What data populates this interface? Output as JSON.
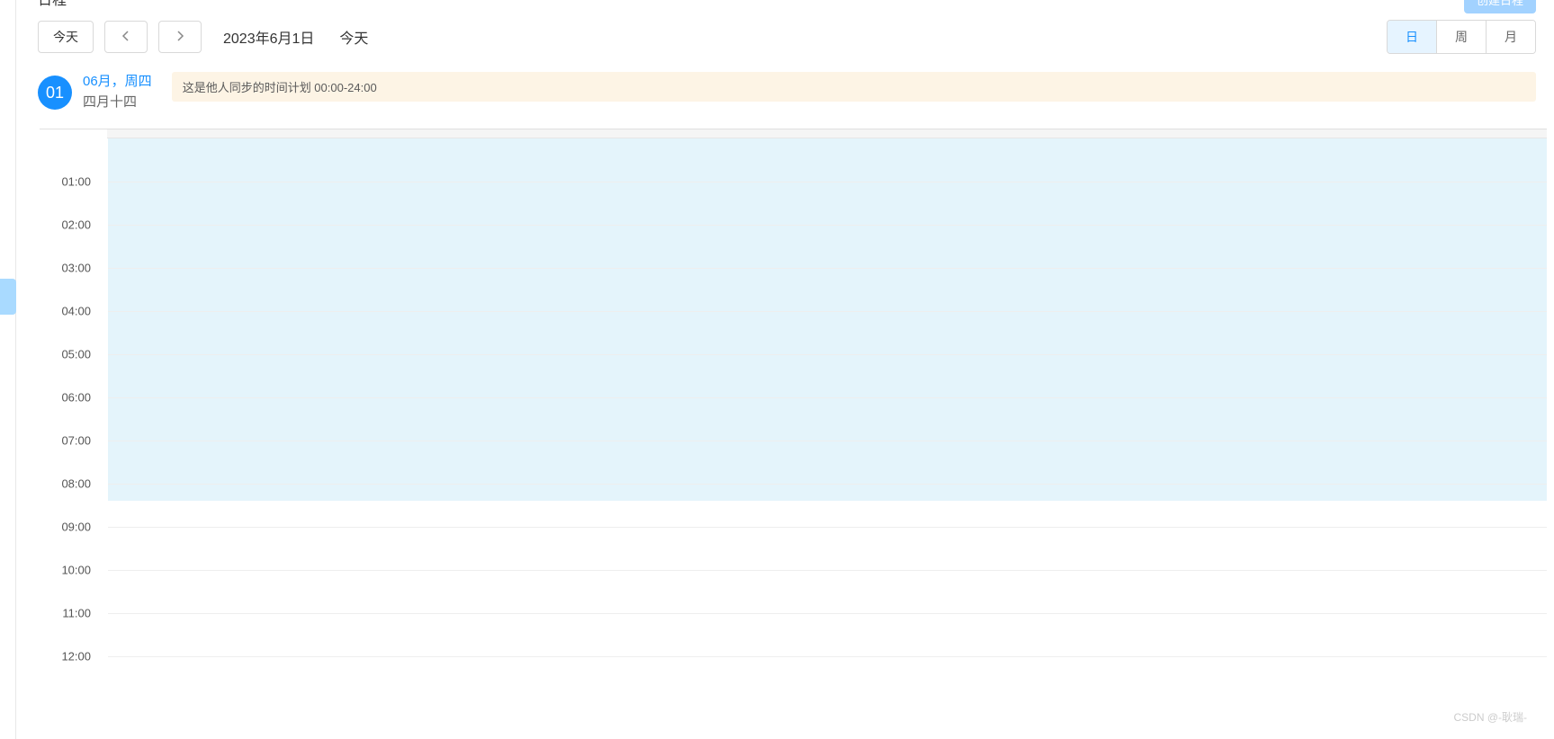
{
  "header": {
    "pageTitle": "日程",
    "createButton": "创建日程"
  },
  "toolbar": {
    "todayButton": "今天",
    "dateTitle": "2023年6月1日",
    "todayLabel": "今天",
    "viewOptions": {
      "day": "日",
      "week": "周",
      "month": "月"
    }
  },
  "dayHeader": {
    "dayNumber": "01",
    "monthWeekday": "06月，周四",
    "lunar": "四月十四",
    "alldayEvent": "这是他人同步的时间计划  00:00-24:00"
  },
  "timeGrid": {
    "hourHeight": 48,
    "highlightEndHour": 8.4,
    "hours": [
      "01:00",
      "02:00",
      "03:00",
      "04:00",
      "05:00",
      "06:00",
      "07:00",
      "08:00",
      "09:00",
      "10:00",
      "11:00",
      "12:00"
    ]
  },
  "watermark": "CSDN @-耿瑞-"
}
